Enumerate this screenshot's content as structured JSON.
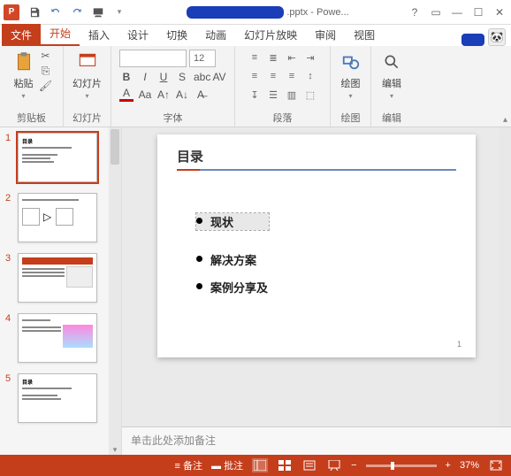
{
  "title": {
    "suffix": ".pptx - Powe...",
    "help": "?"
  },
  "tabs": {
    "file": "文件",
    "home": "开始",
    "insert": "插入",
    "design": "设计",
    "transitions": "切换",
    "animations": "动画",
    "slideshow": "幻灯片放映",
    "review": "审阅",
    "view": "视图"
  },
  "ribbon": {
    "clipboard": {
      "paste": "粘贴",
      "label": "剪贴板"
    },
    "slides": {
      "btn": "幻灯片",
      "label": "幻灯片"
    },
    "font": {
      "name": "",
      "size": "12",
      "label": "字体"
    },
    "paragraph": {
      "label": "段落"
    },
    "drawing": {
      "btn": "绘图",
      "label": "绘图"
    },
    "editing": {
      "btn": "编辑",
      "label": "编辑"
    }
  },
  "thumbs": [
    "1",
    "2",
    "3",
    "4",
    "5"
  ],
  "slide": {
    "title": "目录",
    "bullets": [
      "现状",
      "解决方案",
      "案例分享及"
    ],
    "page": "1"
  },
  "notes": {
    "placeholder": "单击此处添加备注"
  },
  "status": {
    "notes": "备注",
    "comments": "批注",
    "zoom": "37%",
    "minus": "−",
    "plus": "+"
  }
}
